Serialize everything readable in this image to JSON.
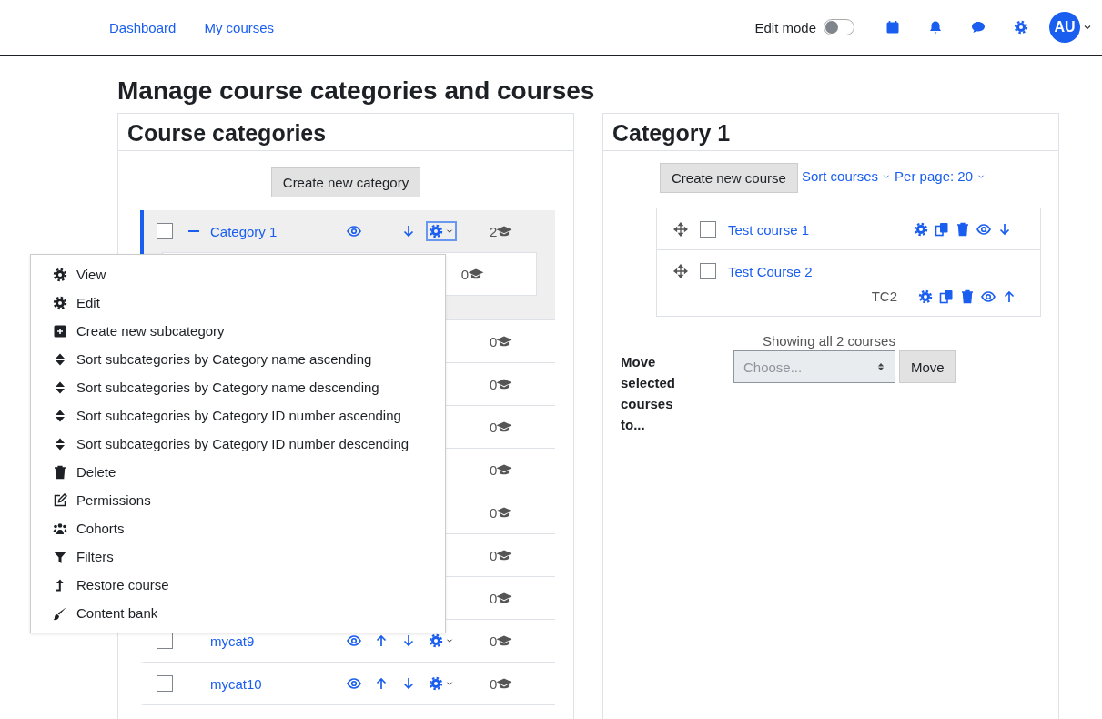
{
  "nav": {
    "links": [
      {
        "label": "Dashboard"
      },
      {
        "label": "My courses"
      }
    ],
    "edit_mode": {
      "label": "Edit mode",
      "on": false
    },
    "user": {
      "initials": "AU"
    }
  },
  "page_title": "Manage course categories and courses",
  "categories_panel": {
    "title": "Course categories",
    "create_button": "Create new category",
    "rows": [
      {
        "name": "Category 1",
        "checked": false,
        "expanded": true,
        "selected": true,
        "up": false,
        "down": true,
        "count": "2",
        "children": [
          {
            "count": "0"
          }
        ]
      },
      {
        "count": "0"
      },
      {
        "count": "0"
      },
      {
        "count": "0"
      },
      {
        "count": "0"
      },
      {
        "count": "0"
      },
      {
        "count": "0"
      },
      {
        "count": "0"
      },
      {
        "name": "mycat9",
        "checked": false,
        "selected": false,
        "up": true,
        "down": true,
        "count": "0"
      },
      {
        "name": "mycat10",
        "checked": false,
        "selected": false,
        "up": true,
        "down": true,
        "count": "0"
      }
    ],
    "menu": {
      "items": [
        {
          "label": "View",
          "kind": "gear"
        },
        {
          "label": "Edit",
          "kind": "gear"
        },
        {
          "label": "Create new subcategory",
          "kind": "add"
        },
        {
          "label": "Sort subcategories by Category name ascending",
          "kind": "sort"
        },
        {
          "label": "Sort subcategories by Category name descending",
          "kind": "sort"
        },
        {
          "label": "Sort subcategories by Category ID number ascending",
          "kind": "sort"
        },
        {
          "label": "Sort subcategories by Category ID number descending",
          "kind": "sort"
        },
        {
          "label": "Delete",
          "kind": "trash"
        },
        {
          "label": "Permissions",
          "kind": "edit"
        },
        {
          "label": "Cohorts",
          "kind": "users"
        },
        {
          "label": "Filters",
          "kind": "filter"
        },
        {
          "label": "Restore course",
          "kind": "restore"
        },
        {
          "label": "Content bank",
          "kind": "brush"
        }
      ]
    }
  },
  "category_panel": {
    "title": "Category 1",
    "create_button": "Create new course",
    "sort_link": "Sort courses",
    "per_page_link": "Per page: 20",
    "courses": [
      {
        "name": "Test course 1",
        "checked": false,
        "up": false,
        "down": true
      },
      {
        "name": "Test Course 2",
        "checked": false,
        "idnumber": "TC2",
        "up": true,
        "down": false
      }
    ],
    "showing": "Showing all 2 courses",
    "move_form": {
      "label": "Move selected courses to...",
      "placeholder": "Choose...",
      "button": "Move"
    }
  }
}
